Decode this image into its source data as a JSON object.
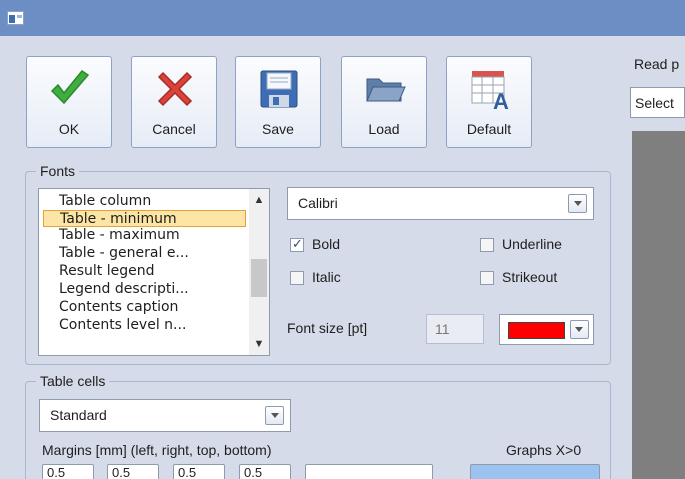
{
  "toolbar": {
    "ok_label": "OK",
    "cancel_label": "Cancel",
    "save_label": "Save",
    "load_label": "Load",
    "default_label": "Default"
  },
  "fonts": {
    "group_label": "Fonts",
    "items": [
      "Table column",
      "Table - minimum",
      "Table - maximum",
      "Table - general e...",
      "Result legend",
      "Legend descripti...",
      "Contents caption",
      "Contents level n..."
    ],
    "selected_index": 1,
    "font_name": "Calibri",
    "bold_label": "Bold",
    "bold_checked": true,
    "underline_label": "Underline",
    "underline_checked": false,
    "italic_label": "Italic",
    "italic_checked": false,
    "strikeout_label": "Strikeout",
    "strikeout_checked": false,
    "font_size_label": "Font size [pt]",
    "font_size_value": "11",
    "font_color": "#ff0000"
  },
  "table_cells": {
    "group_label": "Table cells",
    "style_value": "Standard",
    "margins_label": "Margins [mm] (left, right, top, bottom)",
    "graphs_label": "Graphs X>0",
    "margin_values": [
      "0.5",
      "0.5",
      "0.5",
      "0.5"
    ]
  },
  "right_panel": {
    "read_label": "Read p",
    "select_value": "Select"
  },
  "colors": {
    "titlebar": "#6c8ec4",
    "background": "#d6dbe9",
    "selection": "#fde5a6",
    "selection_border": "#e8a03a",
    "ok_green": "#3fae3f",
    "cancel_red": "#d9433a"
  }
}
